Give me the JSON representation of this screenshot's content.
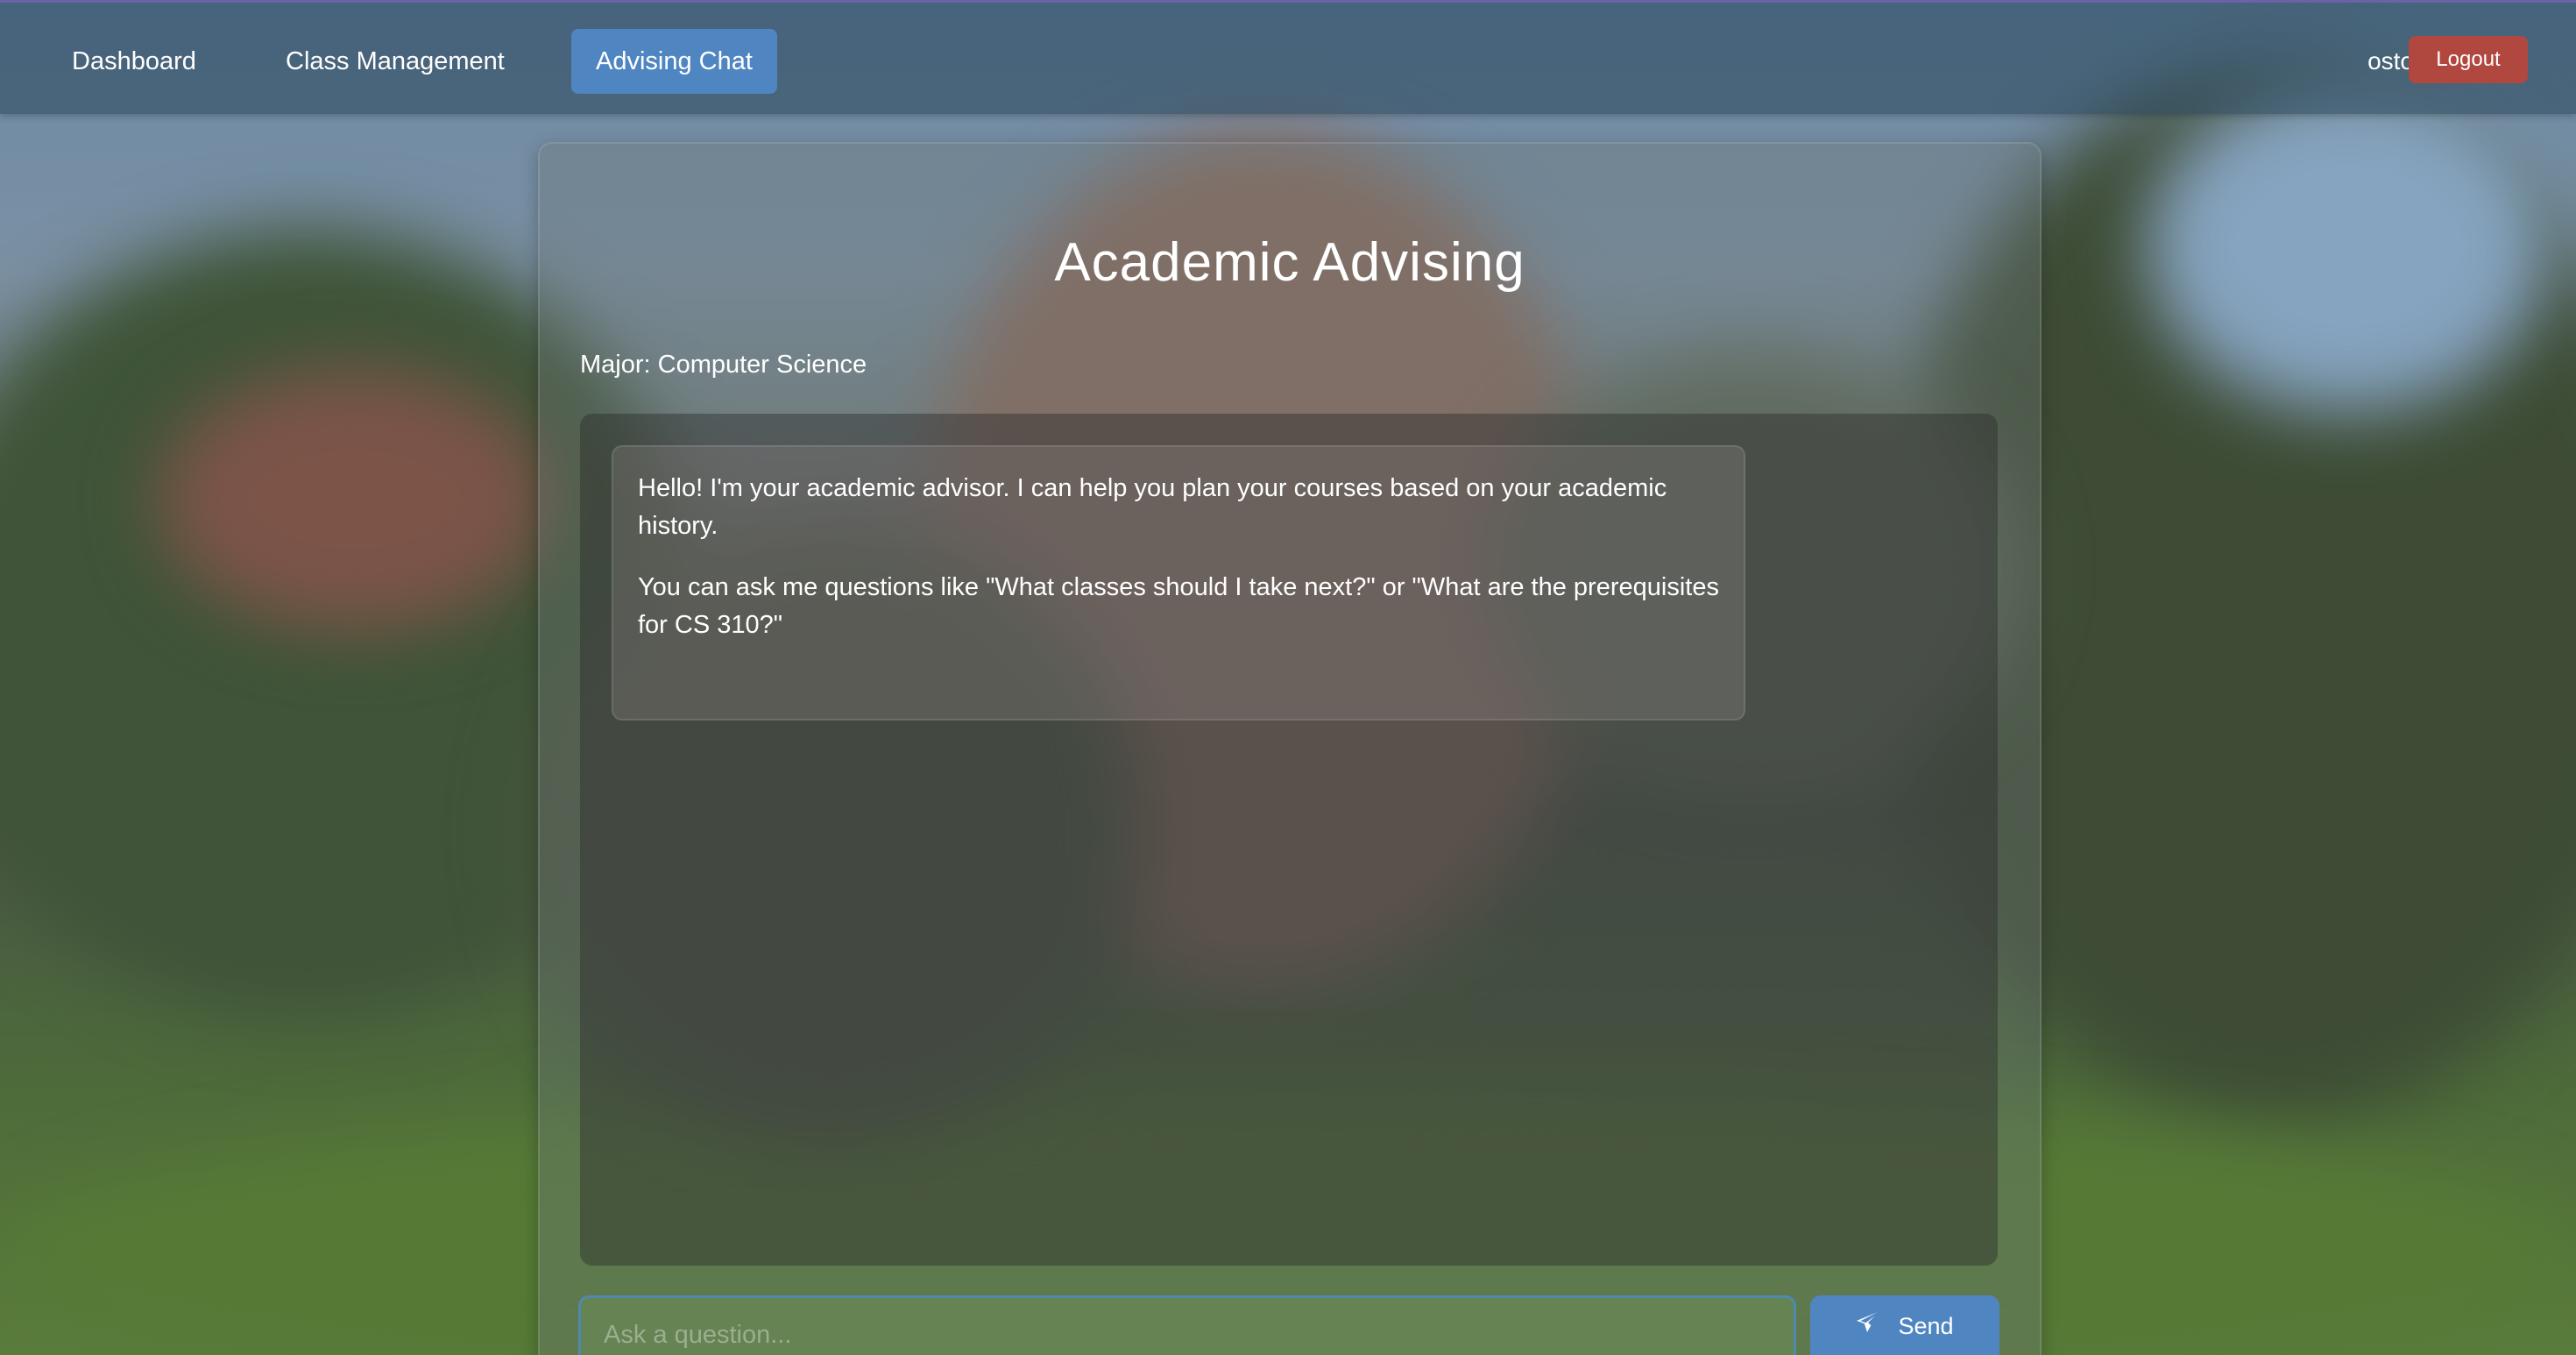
{
  "nav": {
    "links": [
      {
        "label": "Dashboard"
      },
      {
        "label": "Class Management"
      },
      {
        "label": "Advising Chat",
        "active": true
      }
    ],
    "username": "osto",
    "logout_label": "Logout"
  },
  "page": {
    "title": "Academic Advising",
    "major": "Major: Computer Science"
  },
  "chat": {
    "messages": [
      {
        "role": "advisor",
        "paragraphs": [
          "Hello! I'm your academic advisor. I can help you plan your courses based on your academic history.",
          "You can ask me questions like \"What classes should I take next?\" or \"What are the prerequisites for CS 310?\""
        ]
      }
    ]
  },
  "composer": {
    "placeholder": "Ask a question...",
    "send_label": "Send",
    "send_icon": "paper-plane-icon"
  },
  "colors": {
    "accent": "#4f86c2",
    "logout": "#b04840"
  }
}
